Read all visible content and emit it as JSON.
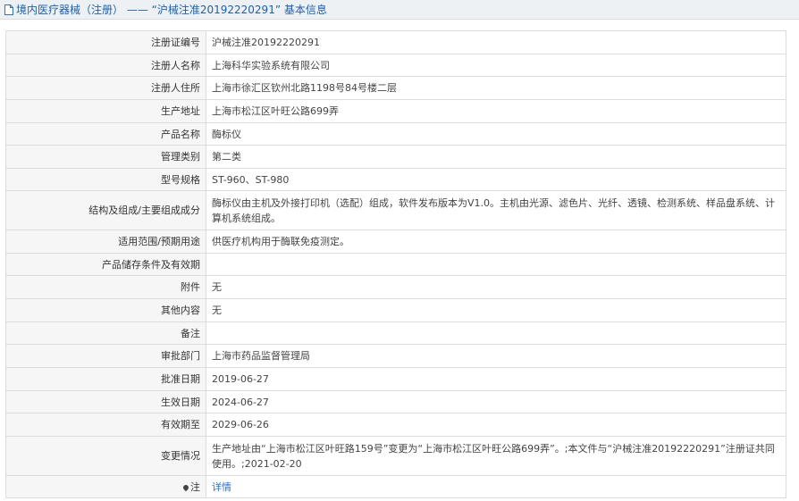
{
  "header": {
    "title": "境内医疗器械（注册） —— “沪械注准20192220291” 基本信息"
  },
  "rows": [
    {
      "label": "注册证编号",
      "value": "沪械注准20192220291"
    },
    {
      "label": "注册人名称",
      "value": "上海科华实验系统有限公司"
    },
    {
      "label": "注册人住所",
      "value": "上海市徐汇区钦州北路1198号84号楼二层"
    },
    {
      "label": "生产地址",
      "value": "上海市松江区叶旺公路699弄"
    },
    {
      "label": "产品名称",
      "value": "酶标仪"
    },
    {
      "label": "管理类别",
      "value": "第二类"
    },
    {
      "label": "型号规格",
      "value": "ST-960、ST-980"
    },
    {
      "label": "结构及组成/主要组成成分",
      "value": "酶标仪由主机及外接打印机（选配）组成，软件发布版本为V1.0。主机由光源、滤色片、光纤、透镜、检测系统、样品盘系统、计算机系统组成。"
    },
    {
      "label": "适用范围/预期用途",
      "value": "供医疗机构用于酶联免疫测定。"
    },
    {
      "label": "产品储存条件及有效期",
      "value": ""
    },
    {
      "label": "附件",
      "value": "无"
    },
    {
      "label": "其他内容",
      "value": "无"
    },
    {
      "label": "备注",
      "value": ""
    },
    {
      "label": "审批部门",
      "value": "上海市药品监督管理局"
    },
    {
      "label": "批准日期",
      "value": "2019-06-27"
    },
    {
      "label": "生效日期",
      "value": "2024-06-27"
    },
    {
      "label": "有效期至",
      "value": "2029-06-26"
    },
    {
      "label": "变更情况",
      "value": "生产地址由“上海市松江区叶旺路159号”变更为“上海市松江区叶旺公路699弄”。;本文件与“沪械注准20192220291”注册证共同使用。;2021-02-20"
    }
  ],
  "note": {
    "label": "注",
    "link_label": "详情"
  }
}
